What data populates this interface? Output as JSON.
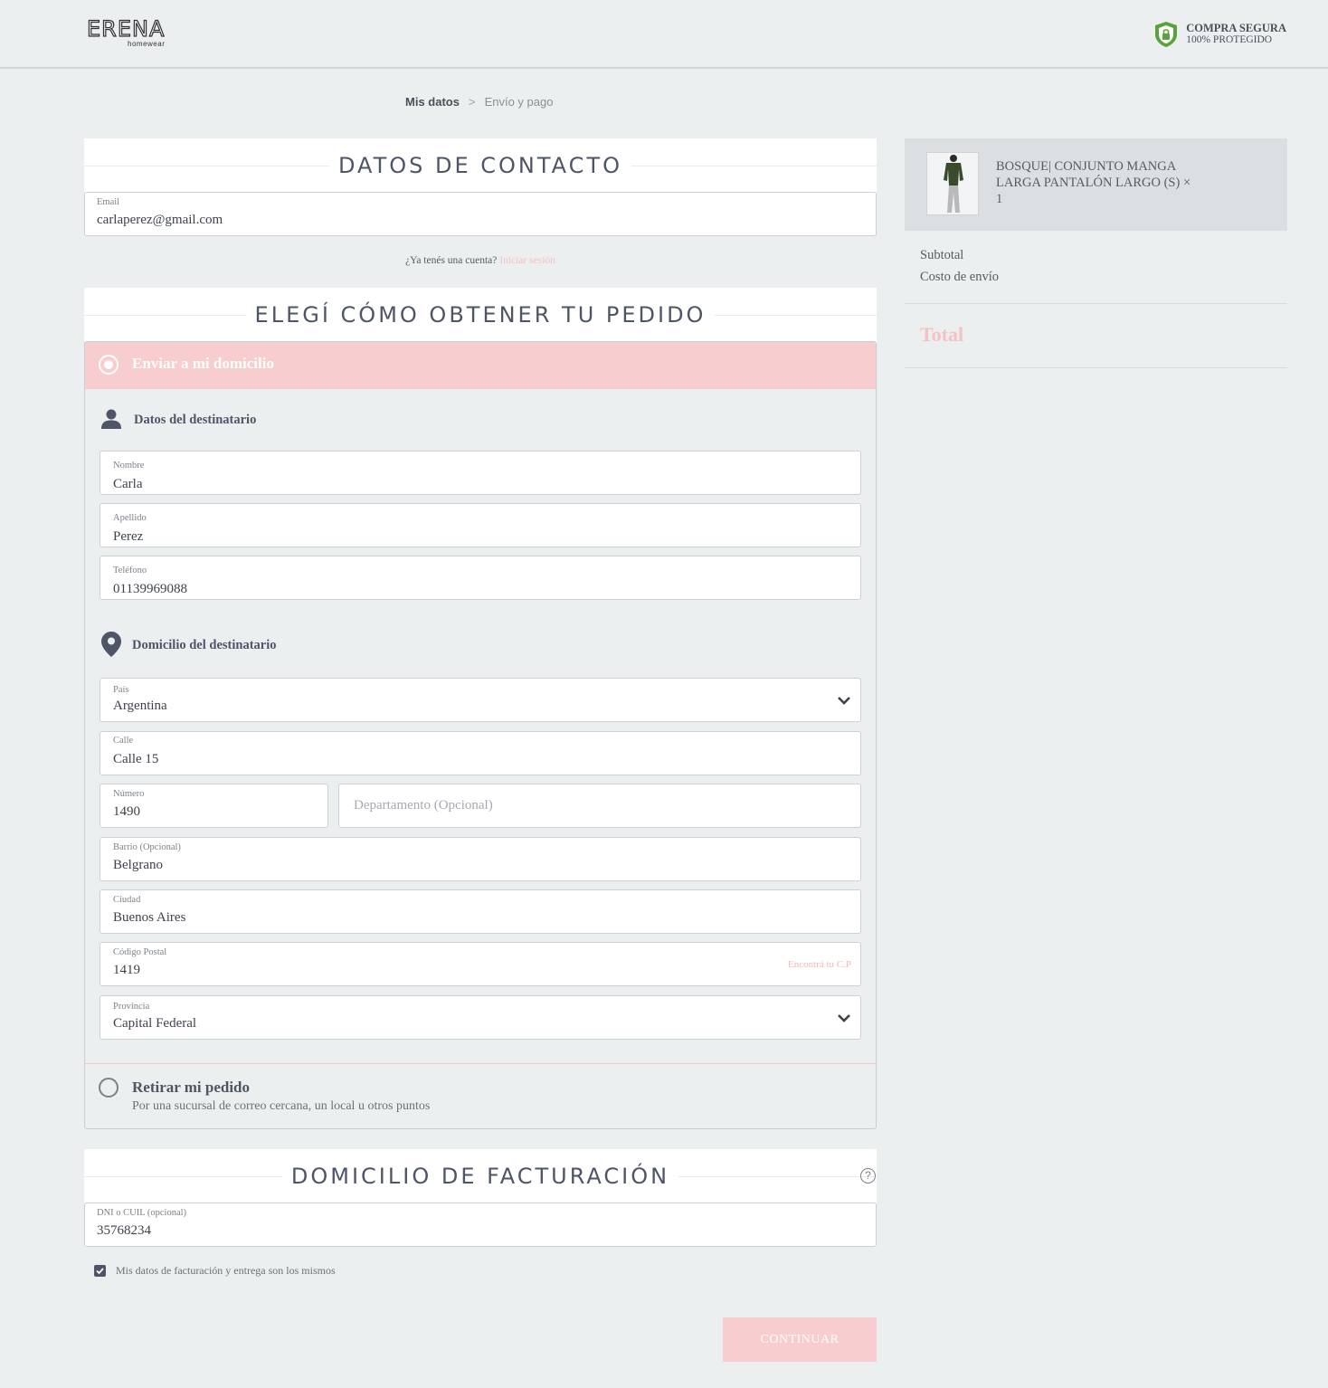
{
  "header": {
    "logo_text": "ERENA",
    "logo_sub": "homewear",
    "secure_line1": "COMPRA SEGURA",
    "secure_line2": "100% PROTEGIDO"
  },
  "breadcrumb": {
    "step1": "Mis datos",
    "separator": ">",
    "step2": "Envío y pago"
  },
  "contact": {
    "title": "DATOS DE CONTACTO",
    "email_label": "Email",
    "email_value": "carlaperez@gmail.com",
    "account_question": "¿Ya tenés una cuenta?",
    "login_link": "Iniciar sesión"
  },
  "delivery": {
    "title": "ELEGÍ CÓMO OBTENER TU PEDIDO",
    "option_home": "Enviar a mi domicilio",
    "recipient_heading": "Datos del destinatario",
    "nombre_label": "Nombre",
    "nombre_value": "Carla",
    "apellido_label": "Apellido",
    "apellido_value": "Perez",
    "telefono_label": "Teléfono",
    "telefono_value": "01139969088",
    "address_heading": "Domicilio del destinatario",
    "pais_label": "País",
    "pais_value": "Argentina",
    "calle_label": "Calle",
    "calle_value": "Calle 15",
    "numero_label": "Número",
    "numero_value": "1490",
    "depto_placeholder": "Departamento (Opcional)",
    "barrio_label": "Barrio (Opcional)",
    "barrio_value": "Belgrano",
    "ciudad_label": "Ciudad",
    "ciudad_value": "Buenos Aires",
    "cp_label": "Código Postal",
    "cp_value": "1419",
    "cp_link": "Encontrá tu C.P",
    "provincia_label": "Provincia",
    "provincia_value": "Capital Federal",
    "option_pickup": "Retirar mi pedido",
    "option_pickup_desc": "Por una sucursal de correo cercana, un local u otros puntos"
  },
  "billing": {
    "title": "DOMICILIO DE FACTURACIÓN",
    "help_icon": "?",
    "dni_label": "DNI o CUIL (opcional)",
    "dni_value": "35768234",
    "same_data_label": "Mis datos de facturación y entrega son los mismos",
    "same_data_checked": true
  },
  "continue_label": "CONTINUAR",
  "summary": {
    "product_name": "BOSQUE| CONJUNTO MANGA LARGA PANTALÓN LARGO (S) ×",
    "product_qty": "1",
    "subtotal_label": "Subtotal",
    "shipping_label": "Costo de envío",
    "total_label": "Total"
  },
  "colors": {
    "accent_pink": "#f7cdcf",
    "text_dark": "#4e5566",
    "secure_green": "#5aa33a",
    "background": "#eceff0"
  }
}
